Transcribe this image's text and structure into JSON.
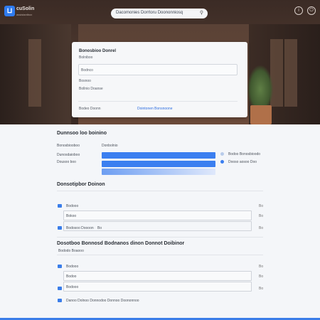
{
  "app": {
    "name": "cuSolin",
    "tagline": "assistantbox"
  },
  "search": {
    "text": "Dacomonies Dorrtoru Doononniosq"
  },
  "topbar_icons": [
    "help-icon",
    "power-icon"
  ],
  "card": {
    "title": "Bonosbioo Donrel",
    "subtitle": "Bolniboo",
    "input_value": "Bodnco",
    "label2": "Bosnoo",
    "field2": "Bollnio Doanse",
    "footer_left": "Bodeo Doonn",
    "footer_link": "Dointonen Bonsnoone"
  },
  "section1": {
    "title": "Dunnsoo loo boinino",
    "col1": "Bonosbiooboo",
    "col2": "Donbolnio",
    "rows": [
      "Dunosdaioboo",
      "Dousoo boo"
    ],
    "legend": [
      "Bodoo Bonosbioodo",
      "Dooso aosoo Doo"
    ],
    "colors": {
      "primary": "#3b7ff0",
      "muted": "#b8cbea"
    }
  },
  "section2": {
    "title": "Donsotipbor Doinon",
    "rows": [
      {
        "left": "Bodooo",
        "box": "",
        "x": "Bo"
      },
      {
        "left": "",
        "box": "Bokoo",
        "x": "Bo"
      },
      {
        "left": "Bodosoo Doooon",
        "box": "Bo",
        "x": "Bo"
      }
    ]
  },
  "section3": {
    "title": "Dosotboo Bonnosd Bodnanos dinon Donnot Doibinor",
    "sub": "Bododo Boaooo",
    "rows": [
      {
        "left": "Bodooo",
        "box": "",
        "x": "Bo"
      },
      {
        "left": "",
        "box": "Bodoo",
        "x": "Bo"
      },
      {
        "left": "",
        "box": "Bodooo",
        "x": "Bo"
      }
    ],
    "footnote": "Danoo Dolnoo Donnodoo Donnoo Doononnoo"
  }
}
